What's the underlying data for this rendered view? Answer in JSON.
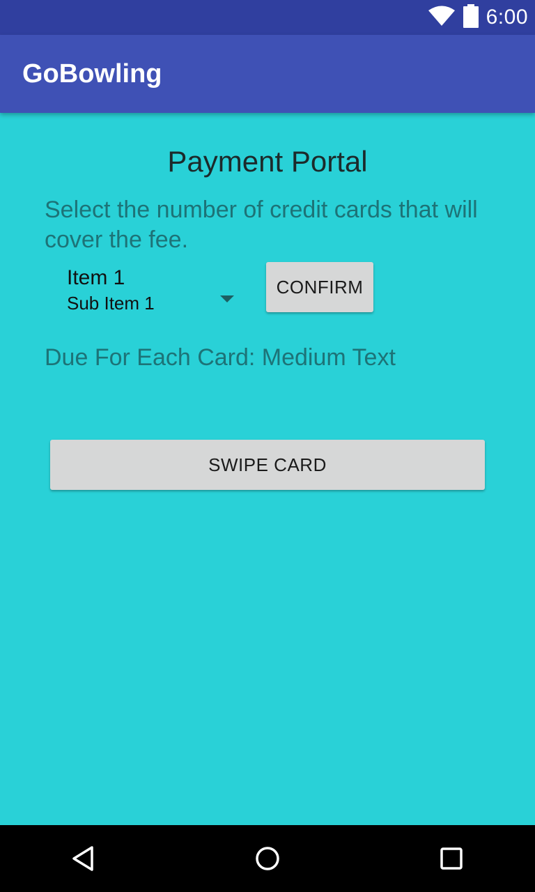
{
  "status_bar": {
    "time": "6:00",
    "icons": [
      "wifi-icon",
      "battery-icon"
    ]
  },
  "app_bar": {
    "title": "GoBowling"
  },
  "main": {
    "title": "Payment Portal",
    "instructions": "Select the number of credit cards that will cover the fee.",
    "spinner": {
      "item": "Item 1",
      "subitem": "Sub Item 1"
    },
    "confirm_label": "CONFIRM",
    "due_text": "Due For Each Card: Medium Text",
    "swipe_label": "SWIPE CARD"
  },
  "nav_bar": {
    "icons": [
      "back-icon",
      "home-icon",
      "recents-icon"
    ]
  },
  "colors": {
    "status_bar": "#303f9f",
    "app_bar": "#3f51b5",
    "background": "#29d1d7",
    "button": "#d6d7d7",
    "secondary_text": "#1d7377"
  }
}
